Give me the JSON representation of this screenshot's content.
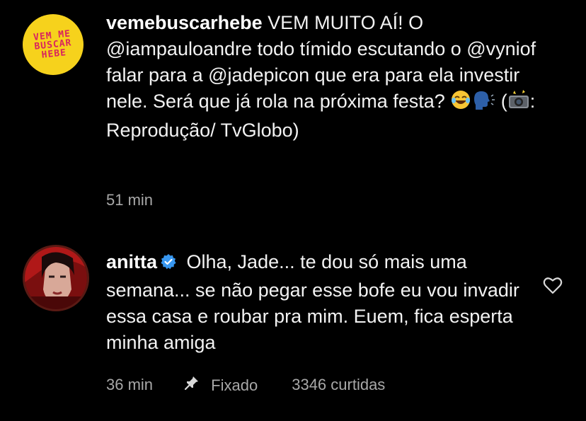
{
  "post": {
    "avatar_text": "VEM ME BUSCAR HEBE",
    "username": "vemebuscarhebe",
    "caption_part1": " VEM MUITO AÍ! O @iampauloandre todo tímido escutando o @vyniof falar para a @jadepicon que era para ela investir nele. Será que já rola na próxima festa? ",
    "caption_part2": " (",
    "caption_part3": ": Reprodução/ TvGlobo)",
    "time": "51 min",
    "emojis": [
      "laughing-tears-emoji",
      "speaking-head-emoji",
      "camera-flash-emoji"
    ]
  },
  "comment": {
    "username": "anitta",
    "verified": true,
    "text": " Olha, Jade... te dou só mais uma semana... se não pegar esse bofe eu vou invadir essa casa e roubar pra mim. Euem, fica esperta minha amiga",
    "time": "36 min",
    "pinned_label": "Fixado",
    "likes": "3346 curtidas",
    "icons": [
      "heart-icon",
      "pin-icon",
      "verified-badge-icon"
    ]
  },
  "colors": {
    "background": "#000000",
    "text": "#f2f2f2",
    "secondary_text": "#a8a8a8",
    "verified_blue": "#3897f0",
    "hebe_yellow": "#f6d21c",
    "hebe_pink": "#d8235f"
  }
}
